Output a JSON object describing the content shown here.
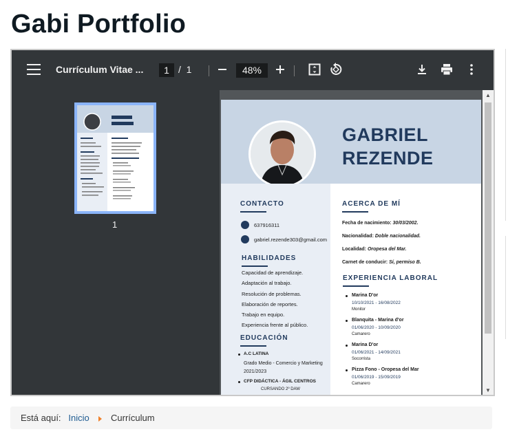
{
  "page": {
    "title": "Gabi Portfolio"
  },
  "viewer": {
    "doc_title": "Currículum Vitae ...",
    "current_page": "1",
    "page_separator": "/",
    "total_pages": "1",
    "zoom": "48%",
    "icons": [
      "menu-icon",
      "zoom-out-icon",
      "zoom-in-icon",
      "fit-page-icon",
      "rotate-icon",
      "download-icon",
      "print-icon",
      "more-vert-icon"
    ],
    "thumbnail_number": "1"
  },
  "cv": {
    "first_name": "GABRIEL",
    "last_name": "REZENDE",
    "contact_title": "CONTACTO",
    "phone": "637916311",
    "email": "gabriel.rezende303@gmail.com",
    "skills_title": "HABILIDADES",
    "skills": [
      "Capacidad de aprendizaje.",
      "Adaptación al trabajo.",
      "Resolución de problemas.",
      "Elaboración de reportes.",
      "Trabajo en equipo.",
      "Experiencia frente al público."
    ],
    "education_title": "EDUCACIÓN",
    "education": [
      {
        "school": "A.C LATINA",
        "course": "Grado Medio - Comercio y Marketing",
        "years": "2021/2023"
      },
      {
        "school": "CFP DIDÁCTICA - ÁGIL CENTROS",
        "course": "CURSANDO 2º DAW"
      }
    ],
    "about_title": "ACERCA DE MÍ",
    "about": [
      {
        "label": "Fecha de nacimiento:",
        "value": "30/03/2002."
      },
      {
        "label": "Nacionalidad:",
        "value": "Doble nacionalidad."
      },
      {
        "label": "Localidad:",
        "value": "Oropesa del Mar."
      },
      {
        "label": "Carnet de conducir:",
        "value": "Sí, permiso B."
      }
    ],
    "experience_title": "EXPERIENCIA LABORAL",
    "experience": [
      {
        "company": "Marina D'or",
        "dates": "10/10/2021 - 16/08/2022",
        "role": "Monitor"
      },
      {
        "company": "Blanquita - Marina d'or",
        "dates": "01/06/2020 - 10/09/2020",
        "role": "Camarero"
      },
      {
        "company": "Marina D'or",
        "dates": "01/06/2021 - 14/09/2021",
        "role": "Socorrista"
      },
      {
        "company": "Pizza Fono - Oropesa del Mar",
        "dates": "01/06/2019 - 15/09/2019",
        "role": "Camarero"
      }
    ]
  },
  "breadcrumb": {
    "prefix": "Está aquí:",
    "home": "Inicio",
    "current": "Currículum"
  },
  "colors": {
    "navy": "#213a5d",
    "header_bg": "#c8d5e4",
    "viewer_bg": "#323639",
    "accent_arrow": "#f0812b"
  }
}
